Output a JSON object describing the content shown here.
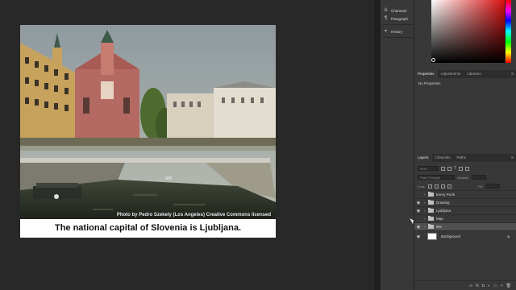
{
  "document": {
    "photo_credit": "Photo by Pedro Szekely (Los Angeles) Creative Commons licensed",
    "caption": "The national capital of Slovenia is Ljubljana."
  },
  "mini_panel": {
    "items": [
      {
        "label": "Character",
        "icon": "character-icon"
      },
      {
        "label": "Paragraph",
        "icon": "paragraph-icon"
      },
      {
        "label": "History",
        "icon": "history-icon"
      }
    ]
  },
  "properties_panel": {
    "tabs": [
      "Properties",
      "Adjustments",
      "Libraries"
    ],
    "active_tab": "Properties",
    "empty_text": "No Properties"
  },
  "layers_panel": {
    "tabs": [
      "Layers",
      "Channels",
      "Paths"
    ],
    "active_tab": "Layers",
    "kind_label": "Kind",
    "blend_mode": "Pass Through",
    "opacity_label": "Opacity:",
    "lock_label": "Lock:",
    "fill_label": "Fill:",
    "layers": [
      {
        "name": "Every Punk",
        "type": "group",
        "visible": false,
        "selected": false
      },
      {
        "name": "Drawing",
        "type": "group",
        "visible": true,
        "selected": false
      },
      {
        "name": "Ljubljana",
        "type": "group",
        "visible": true,
        "selected": false
      },
      {
        "name": "Map",
        "type": "group",
        "visible": false,
        "selected": false
      },
      {
        "name": "title",
        "type": "group",
        "visible": true,
        "selected": true
      },
      {
        "name": "Background",
        "type": "pixel",
        "visible": true,
        "selected": false
      }
    ]
  },
  "colors": {
    "app_bg": "#282828",
    "panel_bg": "#383838",
    "selected_row": "#505050"
  }
}
